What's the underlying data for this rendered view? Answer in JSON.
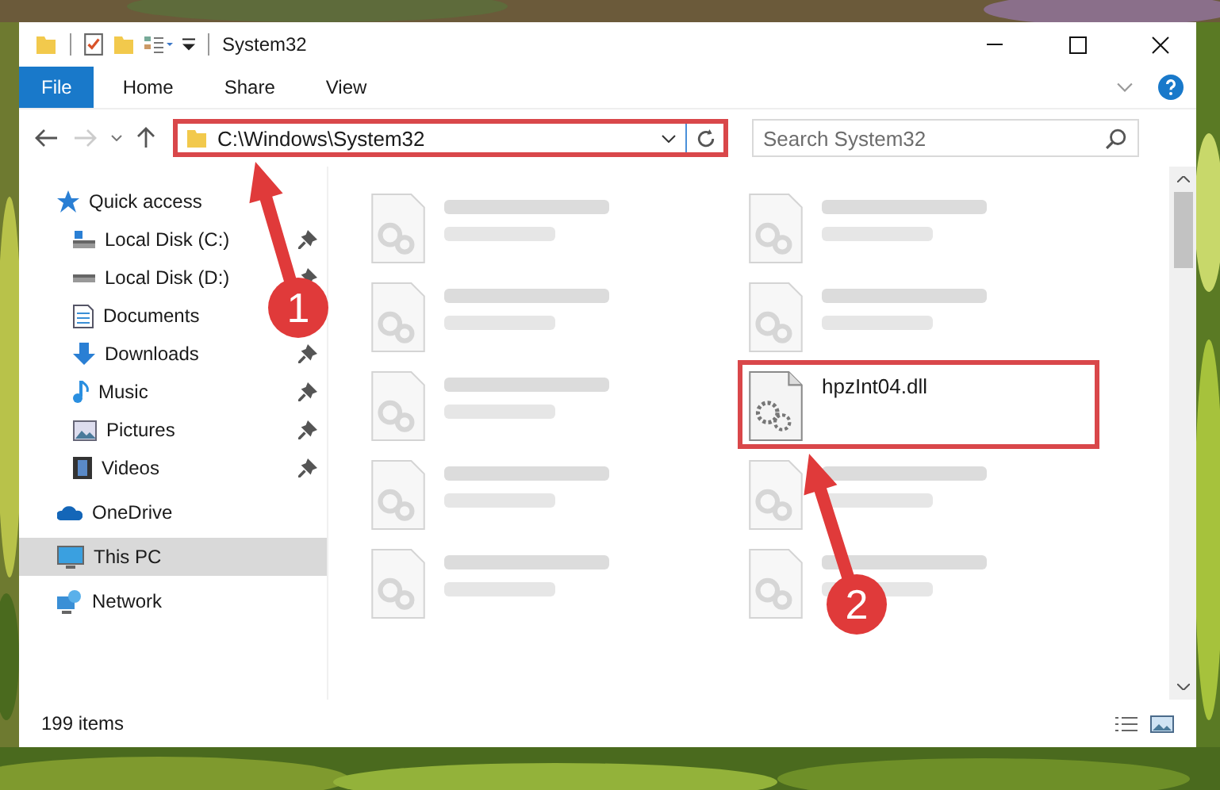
{
  "window": {
    "title": "System32"
  },
  "ribbon_tabs": [
    {
      "label": "File",
      "selected": true
    },
    {
      "label": "Home",
      "selected": false
    },
    {
      "label": "Share",
      "selected": false
    },
    {
      "label": "View",
      "selected": false
    }
  ],
  "address": {
    "value": "C:\\Windows\\System32",
    "highlighted": true
  },
  "search": {
    "placeholder": "Search System32"
  },
  "sidebar": {
    "items": [
      {
        "label": "Quick access",
        "selected": false,
        "children": [
          {
            "label": "Local Disk (C:)",
            "selected": false,
            "pinned": true
          },
          {
            "label": "Local Disk (D:)",
            "selected": false,
            "pinned": true
          },
          {
            "label": "Documents",
            "selected": false
          },
          {
            "label": "Downloads",
            "selected": false,
            "pinned": true
          },
          {
            "label": "Music",
            "selected": false,
            "pinned": true
          },
          {
            "label": "Pictures",
            "selected": false,
            "pinned": true
          },
          {
            "label": "Videos",
            "selected": false,
            "pinned": true
          }
        ]
      },
      {
        "label": "OneDrive",
        "selected": false
      },
      {
        "label": "This PC",
        "selected": true
      },
      {
        "label": "Network",
        "selected": false
      }
    ]
  },
  "files": [
    {
      "kind": "blurred"
    },
    {
      "kind": "blurred"
    },
    {
      "kind": "blurred"
    },
    {
      "kind": "blurred"
    },
    {
      "kind": "blurred"
    },
    {
      "kind": "file",
      "name": "hpzInt04.dll",
      "highlighted": true
    },
    {
      "kind": "blurred"
    },
    {
      "kind": "blurred"
    },
    {
      "kind": "blurred"
    },
    {
      "kind": "blurred"
    }
  ],
  "status_bar": {
    "count": "199 items"
  },
  "annotations": [
    {
      "number": "1"
    },
    {
      "number": "2"
    }
  ]
}
